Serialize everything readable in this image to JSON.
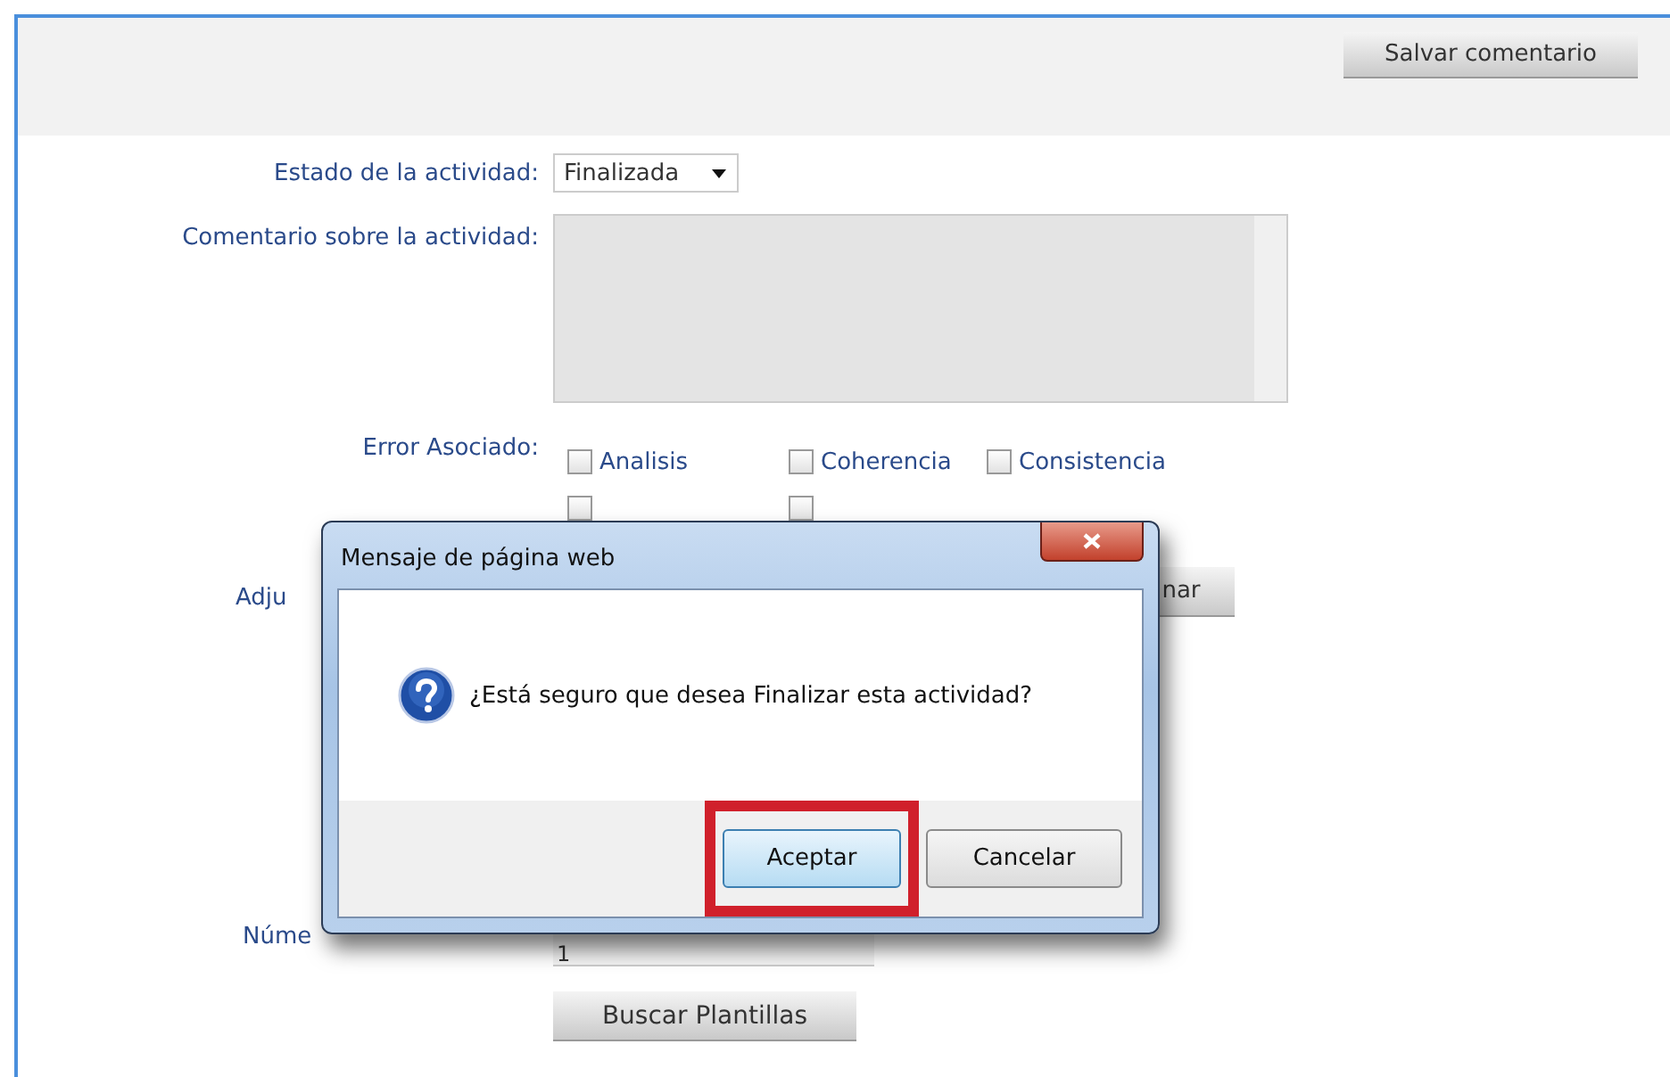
{
  "toolbar": {
    "save_button": "Salvar comentario"
  },
  "form": {
    "status_label": "Estado de la actividad:",
    "status_value": "Finalizada",
    "comment_label": "Comentario sobre la actividad:",
    "error_label": "Error Asociado:",
    "error_options": [
      {
        "label": "Analisis",
        "checked": false
      },
      {
        "label": "Coherencia",
        "checked": false
      },
      {
        "label": "Consistencia",
        "checked": false
      },
      {
        "checked": false
      },
      {
        "checked": false
      }
    ],
    "attach_label": "Adju",
    "attach_button": "nar",
    "number_label": "Núme",
    "number_value": "1",
    "search_button": "Buscar Plantillas"
  },
  "dialog": {
    "title": "Mensaje de página web",
    "message": "¿Está seguro que desea Finalizar esta actividad?",
    "buttons": [
      {
        "label": "Aceptar",
        "highlighted": true
      },
      {
        "label": "Cancelar",
        "highlighted": false
      }
    ]
  }
}
